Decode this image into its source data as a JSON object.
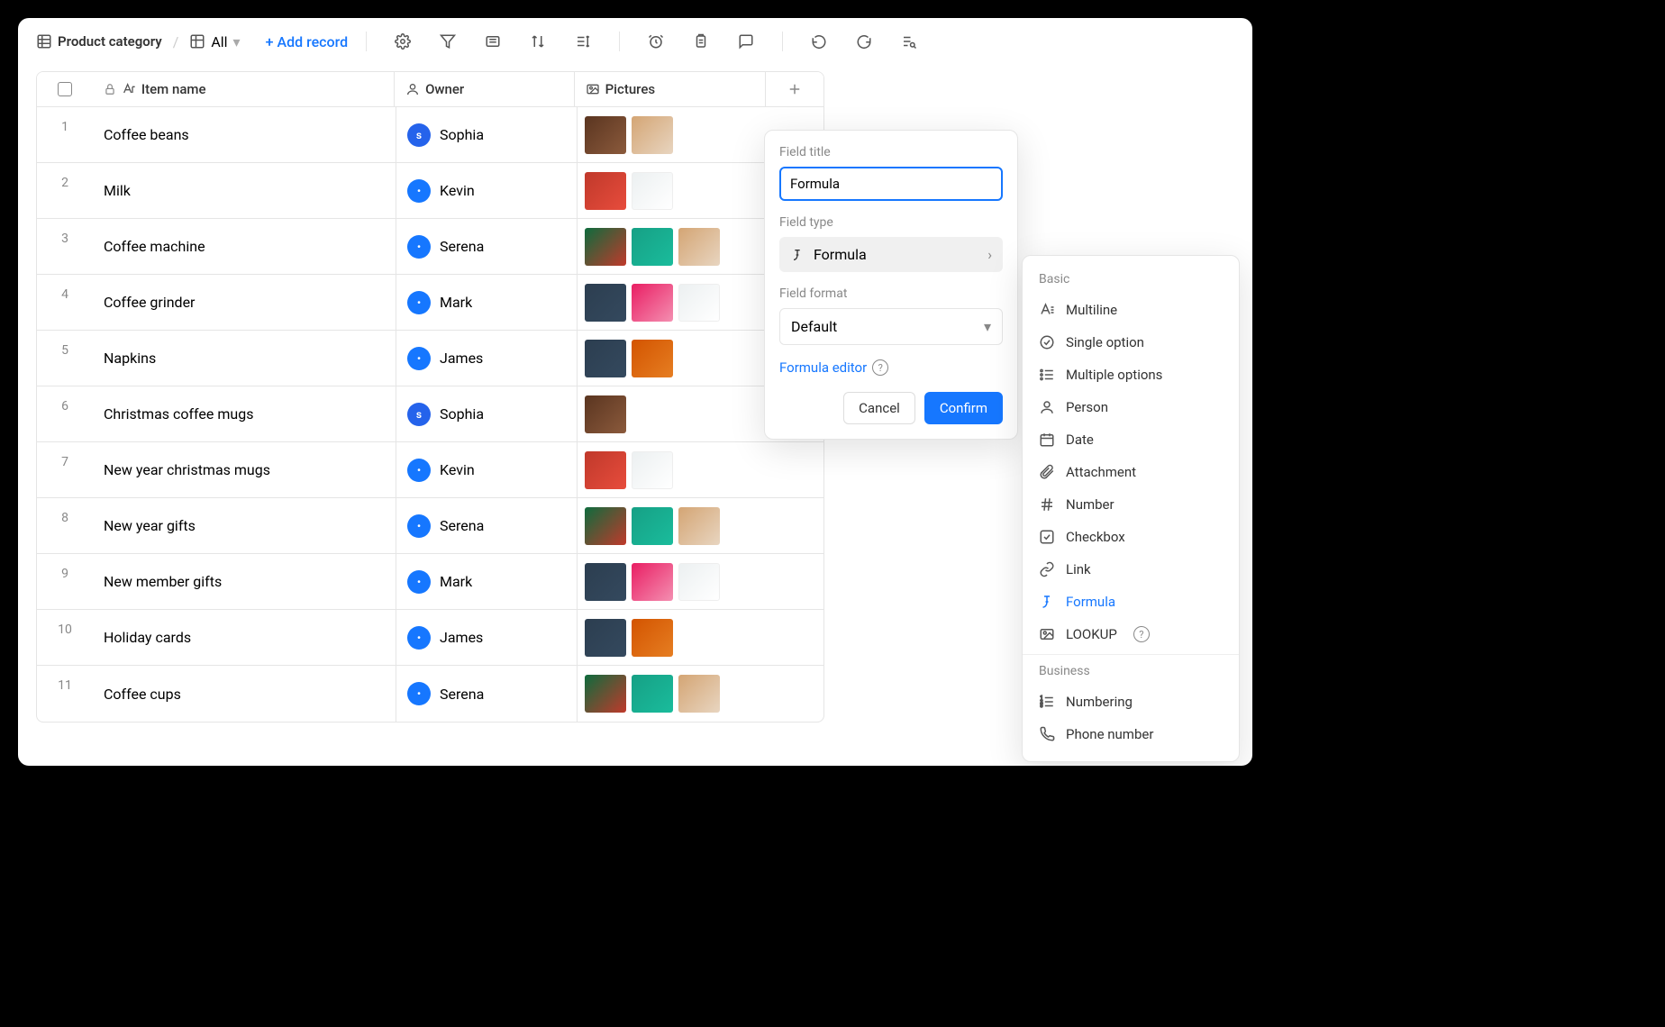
{
  "toolbar": {
    "breadcrumb": "Product category",
    "view": "All",
    "add_record": "Add record"
  },
  "columns": {
    "name": "Item name",
    "owner": "Owner",
    "pictures": "Pictures"
  },
  "rows": [
    {
      "num": "1",
      "name": "Coffee beans",
      "owner": "Sophia",
      "avatar": "s",
      "pics": [
        "brown",
        "latte"
      ]
    },
    {
      "num": "2",
      "name": "Milk",
      "owner": "Kevin",
      "avatar": "",
      "pics": [
        "red",
        "white"
      ]
    },
    {
      "num": "3",
      "name": "Coffee machine",
      "owner": "Serena",
      "avatar": "",
      "pics": [
        "xmas",
        "green",
        "latte"
      ]
    },
    {
      "num": "4",
      "name": "Coffee grinder",
      "owner": "Mark",
      "avatar": "",
      "pics": [
        "dark",
        "pink",
        "white"
      ]
    },
    {
      "num": "5",
      "name": "Napkins",
      "owner": "James",
      "avatar": "",
      "pics": [
        "dark",
        "orange"
      ]
    },
    {
      "num": "6",
      "name": "Christmas coffee mugs",
      "owner": "Sophia",
      "avatar": "s",
      "pics": [
        "brown"
      ]
    },
    {
      "num": "7",
      "name": "New year christmas mugs",
      "owner": "Kevin",
      "avatar": "",
      "pics": [
        "red",
        "white"
      ]
    },
    {
      "num": "8",
      "name": "New year gifts",
      "owner": "Serena",
      "avatar": "",
      "pics": [
        "xmas",
        "green",
        "latte"
      ]
    },
    {
      "num": "9",
      "name": "New member gifts",
      "owner": "Mark",
      "avatar": "",
      "pics": [
        "dark",
        "pink",
        "white"
      ]
    },
    {
      "num": "10",
      "name": "Holiday cards",
      "owner": "James",
      "avatar": "",
      "pics": [
        "dark",
        "orange"
      ]
    },
    {
      "num": "11",
      "name": "Coffee cups",
      "owner": "Serena",
      "avatar": "",
      "pics": [
        "xmas",
        "green",
        "latte"
      ]
    }
  ],
  "popover": {
    "field_title_label": "Field title",
    "field_title_value": "Formula",
    "field_type_label": "Field type",
    "field_type_value": "Formula",
    "field_format_label": "Field format",
    "field_format_value": "Default",
    "formula_editor": "Formula editor",
    "cancel": "Cancel",
    "confirm": "Confirm"
  },
  "typepicker": {
    "basic_label": "Basic",
    "items": [
      "Multiline",
      "Single option",
      "Multiple options",
      "Person",
      "Date",
      "Attachment",
      "Number",
      "Checkbox",
      "Link",
      "Formula",
      "LOOKUP"
    ],
    "business_label": "Business",
    "business_items": [
      "Numbering",
      "Phone number"
    ]
  }
}
